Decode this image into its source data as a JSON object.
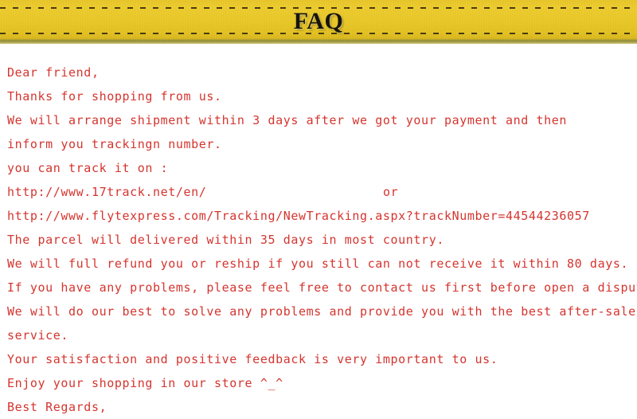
{
  "header": {
    "title": "FAQ",
    "banner_color": "#e9c828",
    "stitch_color": "#4a3a12",
    "title_color": "#17140b"
  },
  "body": {
    "text_color": "#d4352f",
    "background_color": "#ffffff",
    "lines": [
      {
        "text": "Dear friend,"
      },
      {
        "text": "Thanks for shopping from us."
      },
      {
        "text": "We will arrange shipment within 3 days after we got your payment and then"
      },
      {
        "text": "inform you trackingn number."
      },
      {
        "text": "you can track it on :"
      },
      {
        "text": "http://www.17track.net/en/",
        "trailer": "or"
      },
      {
        "text": "http://www.flytexpress.com/Tracking/NewTracking.aspx?trackNumber=44544236057"
      },
      {
        "text": "The parcel will delivered within 35 days in most country."
      },
      {
        "text": "We will full refund you or reship if you still can not receive it within 80 days."
      },
      {
        "text": "If you have any problems, please feel free to contact us first before open a dispute."
      },
      {
        "text": "We will do our best to solve any problems and provide you with the best after-sale"
      },
      {
        "text": "service."
      },
      {
        "text": "Your satisfaction and positive feedback is very important to us."
      },
      {
        "text": "Enjoy your shopping in our store ^_^"
      },
      {
        "text": "Best Regards,"
      }
    ]
  }
}
